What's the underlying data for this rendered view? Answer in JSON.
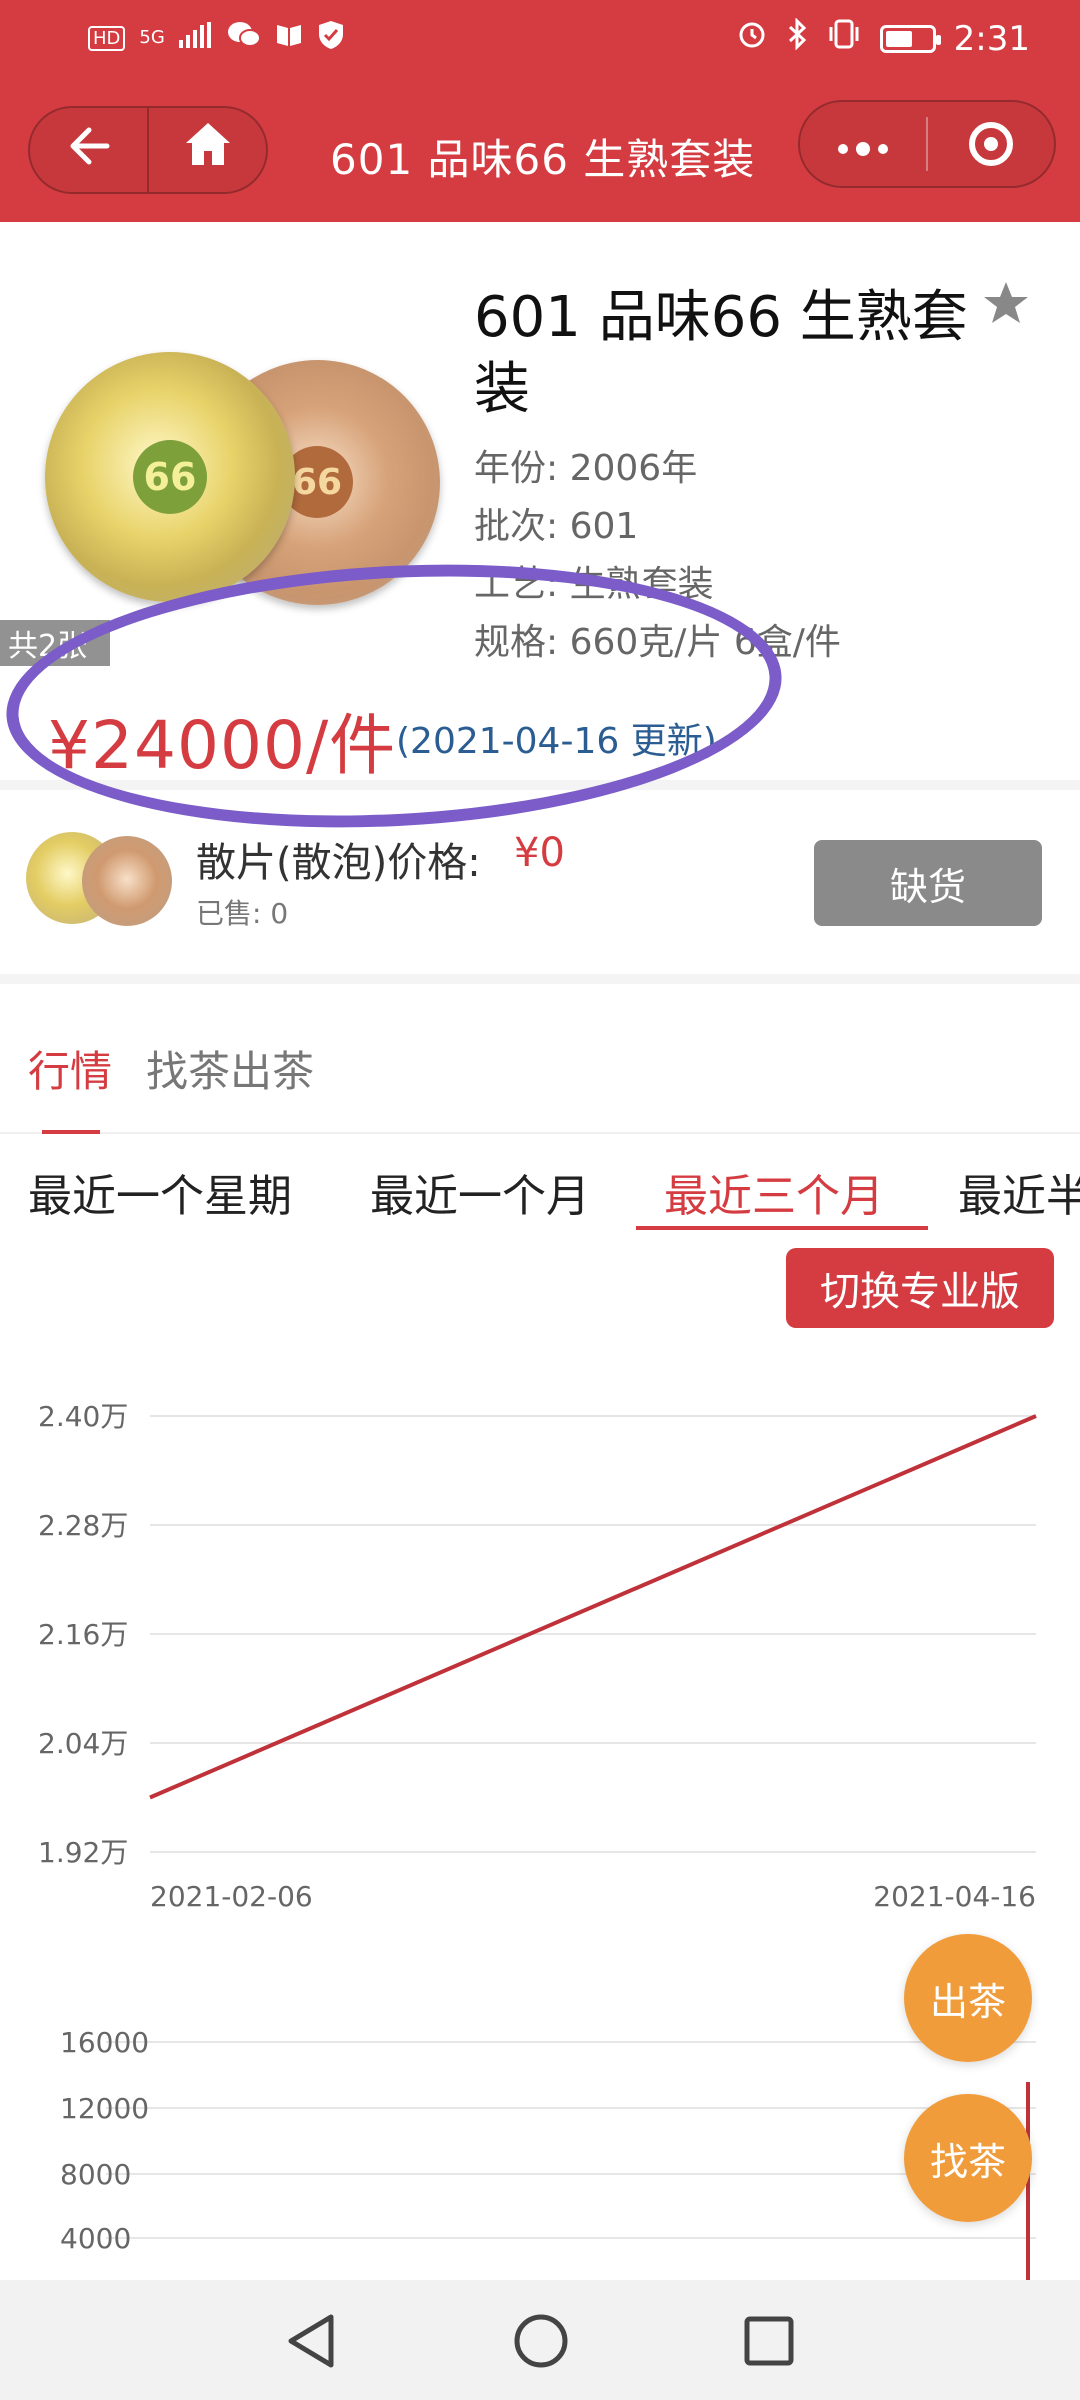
{
  "status_bar": {
    "left_icons": [
      "HD",
      "5G",
      "signal-icon",
      "wechat-icon",
      "book-icon",
      "shield-icon"
    ],
    "time": "2:31",
    "right_icons": [
      "alarm-icon",
      "bluetooth-icon",
      "vibrate-icon",
      "battery-icon"
    ],
    "battery_fraction": 0.6
  },
  "header": {
    "title": "601 品味66 生熟套装",
    "back_icon": "back-arrow-icon",
    "home_icon": "home-icon",
    "more_icon": "more-dots-icon",
    "target_icon": "target-icon",
    "background": "#d43c41"
  },
  "product": {
    "title": "601 品味66 生熟套装",
    "year": "年份: 2006年",
    "batch": "批次: 601",
    "craft": "工艺: 生熟套装",
    "spec": "规格: 660克/片 6盒/件",
    "count_badge": "共2张",
    "price": "¥24000/件",
    "updated": "(2021-04-16 更新)",
    "favorite_icon": "star-icon",
    "cake1_label": "66",
    "cake2_label": "66"
  },
  "loose": {
    "label": "散片(散泡)价格:",
    "price": "¥0",
    "sold": "已售: 0",
    "button": "缺货"
  },
  "tabs": [
    {
      "label": "行情",
      "active": true
    },
    {
      "label": "找茶出茶",
      "active": false
    }
  ],
  "ranges": [
    {
      "label": "最近一个星期",
      "active": false
    },
    {
      "label": "最近一个月",
      "active": false
    },
    {
      "label": "最近三个月",
      "active": true
    },
    {
      "label": "最近半年",
      "active": false
    }
  ],
  "pro_button": "切换专业版",
  "chart_data": [
    {
      "type": "line",
      "x": [
        "2021-02-06",
        "2021-04-16"
      ],
      "xtick_labels": [
        "2021-02-06",
        "2021-04-16"
      ],
      "ytick_labels": [
        "2.40万",
        "2.28万",
        "2.16万",
        "2.04万",
        "1.92万"
      ],
      "ylim": [
        19200,
        24000
      ],
      "series": [
        {
          "values": [
            19800,
            24000
          ]
        }
      ],
      "grid": true,
      "color": "#c0323a"
    },
    {
      "type": "bar",
      "ytick_labels": [
        "16000",
        "12000",
        "8000",
        "4000"
      ],
      "ylim": [
        0,
        16000
      ],
      "grid": true,
      "color": "#c0323a"
    }
  ],
  "fabs": {
    "sell": "出茶",
    "find": "找茶"
  },
  "system_nav": [
    "back-triangle-icon",
    "home-circle-icon",
    "recents-square-icon"
  ]
}
